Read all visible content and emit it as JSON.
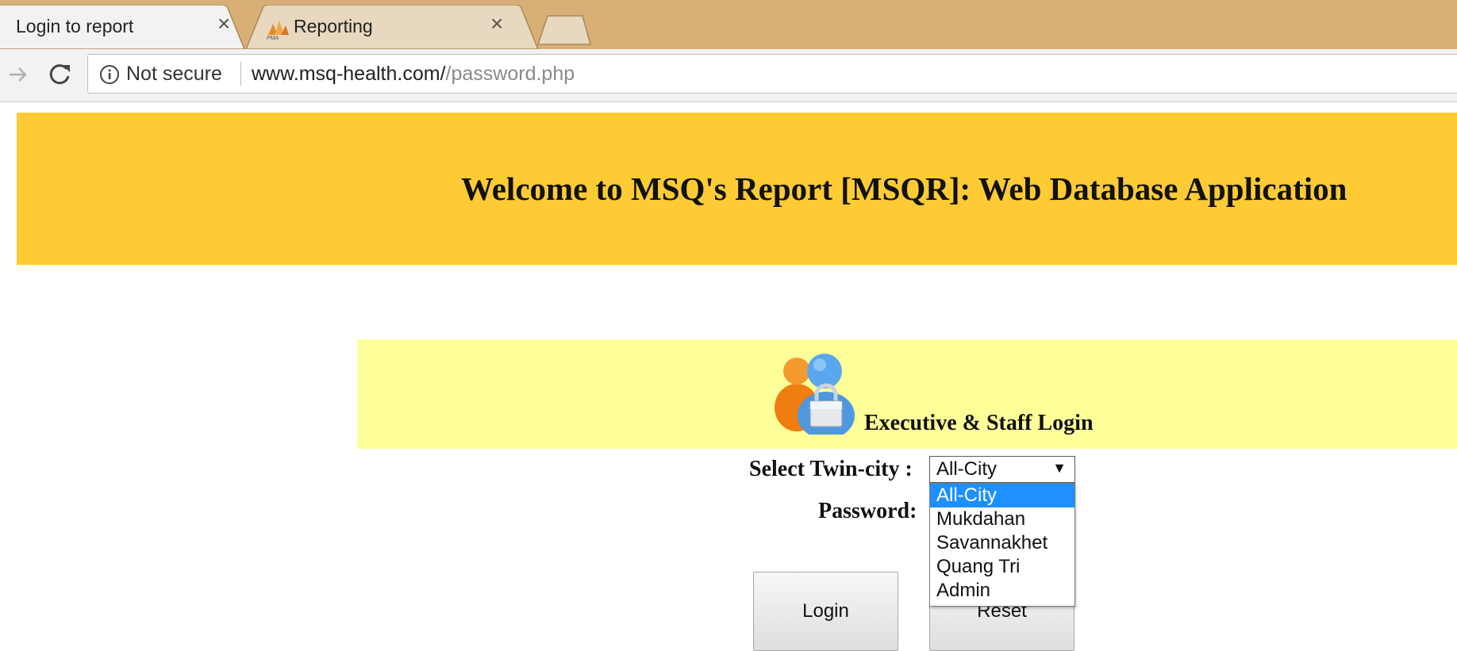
{
  "browser": {
    "tabs": [
      {
        "title": "Login to report",
        "active": true,
        "icon": "none"
      },
      {
        "title": "Reporting",
        "active": false,
        "icon": "pma-logo-icon"
      }
    ],
    "address": {
      "security_label": "Not secure",
      "url_host": "www.msq-health.com/",
      "url_path": "/password.php"
    }
  },
  "page": {
    "banner_title": "Welcome to MSQ's Report [MSQR]: Web Database Application",
    "login_heading": "Executive & Staff Login",
    "twin_city_label": "Select Twin-city :",
    "password_label": "Password:",
    "twin_city_selected": "All-City",
    "twin_city_options": [
      "All-City",
      "Mukdahan",
      "Savannakhet",
      "Quang Tri",
      "Admin"
    ],
    "login_button": "Login",
    "reset_button": "Reset"
  },
  "colors": {
    "banner": "#fecb35",
    "login_panel": "#ffff99",
    "tabstrip": "#d8b077",
    "dropdown_highlight": "#1e90ff"
  }
}
